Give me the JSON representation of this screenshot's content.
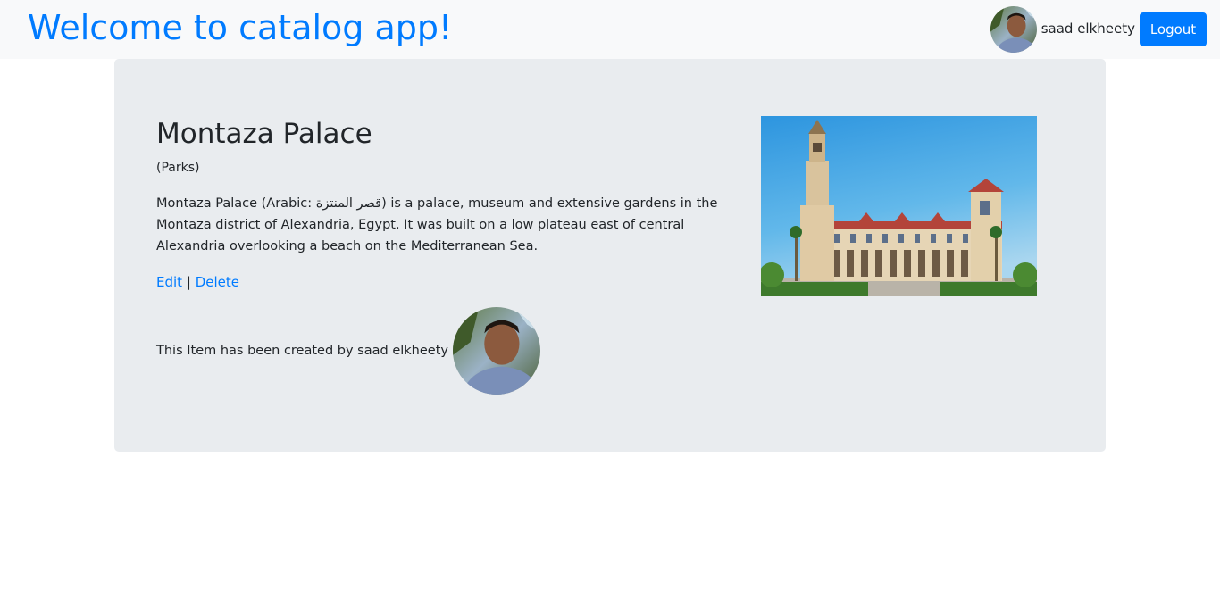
{
  "navbar": {
    "brand": "Welcome to catalog app!",
    "user_name": "saad elkheety",
    "logout_label": "Logout",
    "avatar_icon": "user-photo"
  },
  "item": {
    "title": "Montaza Palace",
    "category": "(Parks)",
    "description": "Montaza Palace (Arabic: قصر المنتزة) is a palace, museum and extensive gardens in the Montaza district of Alexandria, Egypt. It was built on a low plateau east of central Alexandria overlooking a beach on the Mediterranean Sea.",
    "edit_label": "Edit",
    "separator": "|",
    "delete_label": "Delete",
    "creator_text": "This Item has been created by saad elkheety",
    "image_icon": "palace-photo"
  },
  "colors": {
    "primary": "#007bff",
    "navbar_bg": "#f8f9fa",
    "jumbotron_bg": "#e9ecef",
    "text": "#212529"
  }
}
